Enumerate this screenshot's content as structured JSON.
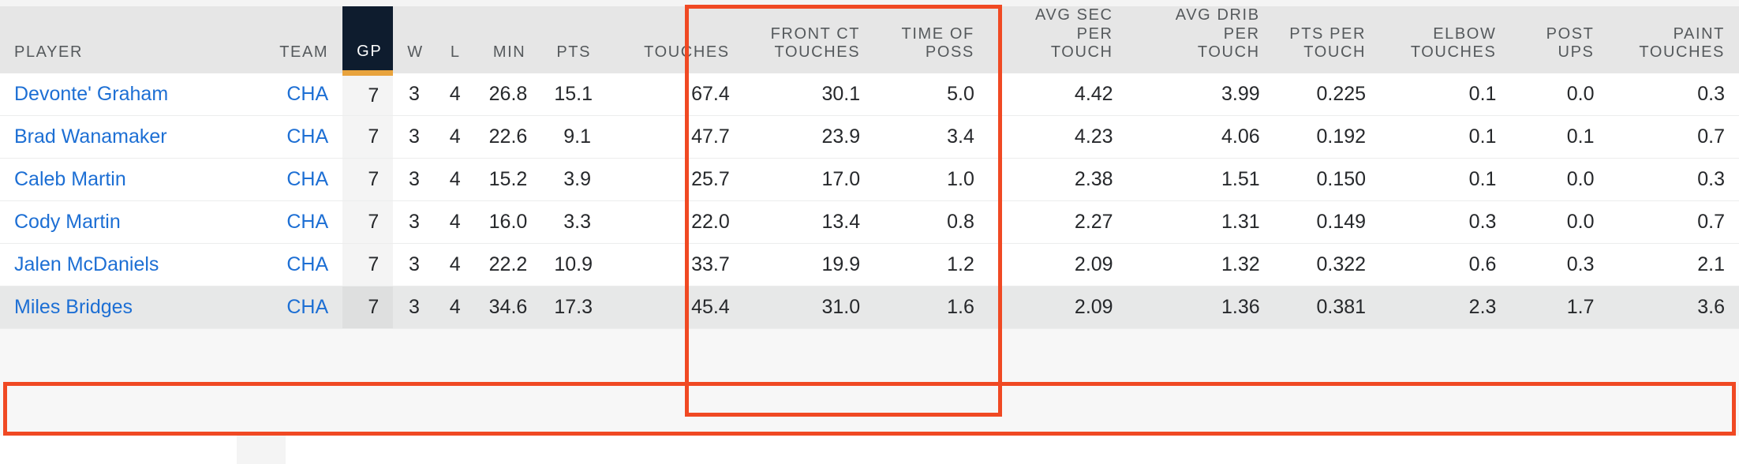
{
  "table": {
    "accent_navy": "#0e1c2e",
    "accent_gold": "#e8a33d",
    "link_blue": "#1d6fd4",
    "annotation_red": "#f04923",
    "columns": [
      {
        "key": "player",
        "label": "PLAYER",
        "align": "left"
      },
      {
        "key": "team",
        "label": "TEAM",
        "align": "right"
      },
      {
        "key": "gp",
        "label": "GP",
        "align": "right"
      },
      {
        "key": "w",
        "label": "W",
        "align": "right"
      },
      {
        "key": "l",
        "label": "L",
        "align": "right"
      },
      {
        "key": "min",
        "label": "MIN",
        "align": "right"
      },
      {
        "key": "pts",
        "label": "PTS",
        "align": "right"
      },
      {
        "key": "touches",
        "label": "TOUCHES",
        "align": "right"
      },
      {
        "key": "fct",
        "label": "FRONT CT\nTOUCHES",
        "align": "right"
      },
      {
        "key": "top",
        "label": "TIME OF\nPOSS",
        "align": "right"
      },
      {
        "key": "aspt",
        "label": "AVG SEC PER\nTOUCH",
        "align": "right"
      },
      {
        "key": "adpt",
        "label": "AVG DRIB PER\nTOUCH",
        "align": "right"
      },
      {
        "key": "ppt",
        "label": "PTS PER\nTOUCH",
        "align": "right"
      },
      {
        "key": "elbow",
        "label": "ELBOW\nTOUCHES",
        "align": "right"
      },
      {
        "key": "postup",
        "label": "POST\nUPS",
        "align": "right"
      },
      {
        "key": "paint",
        "label": "PAINT\nTOUCHES",
        "align": "right"
      }
    ],
    "rows": [
      {
        "player": "Devonte' Graham",
        "team": "CHA",
        "gp": "7",
        "w": "3",
        "l": "4",
        "min": "26.8",
        "pts": "15.1",
        "touches": "67.4",
        "fct": "30.1",
        "top": "5.0",
        "aspt": "4.42",
        "adpt": "3.99",
        "ppt": "0.225",
        "elbow": "0.1",
        "postup": "0.0",
        "paint": "0.3",
        "highlighted": false
      },
      {
        "player": "Brad Wanamaker",
        "team": "CHA",
        "gp": "7",
        "w": "3",
        "l": "4",
        "min": "22.6",
        "pts": "9.1",
        "touches": "47.7",
        "fct": "23.9",
        "top": "3.4",
        "aspt": "4.23",
        "adpt": "4.06",
        "ppt": "0.192",
        "elbow": "0.1",
        "postup": "0.1",
        "paint": "0.7",
        "highlighted": false
      },
      {
        "player": "Caleb Martin",
        "team": "CHA",
        "gp": "7",
        "w": "3",
        "l": "4",
        "min": "15.2",
        "pts": "3.9",
        "touches": "25.7",
        "fct": "17.0",
        "top": "1.0",
        "aspt": "2.38",
        "adpt": "1.51",
        "ppt": "0.150",
        "elbow": "0.1",
        "postup": "0.0",
        "paint": "0.3",
        "highlighted": false
      },
      {
        "player": "Cody Martin",
        "team": "CHA",
        "gp": "7",
        "w": "3",
        "l": "4",
        "min": "16.0",
        "pts": "3.3",
        "touches": "22.0",
        "fct": "13.4",
        "top": "0.8",
        "aspt": "2.27",
        "adpt": "1.31",
        "ppt": "0.149",
        "elbow": "0.3",
        "postup": "0.0",
        "paint": "0.7",
        "highlighted": false
      },
      {
        "player": "Jalen McDaniels",
        "team": "CHA",
        "gp": "7",
        "w": "3",
        "l": "4",
        "min": "22.2",
        "pts": "10.9",
        "touches": "33.7",
        "fct": "19.9",
        "top": "1.2",
        "aspt": "2.09",
        "adpt": "1.32",
        "ppt": "0.322",
        "elbow": "0.6",
        "postup": "0.3",
        "paint": "2.1",
        "highlighted": false
      },
      {
        "player": "Miles Bridges",
        "team": "CHA",
        "gp": "7",
        "w": "3",
        "l": "4",
        "min": "34.6",
        "pts": "17.3",
        "touches": "45.4",
        "fct": "31.0",
        "top": "1.6",
        "aspt": "2.09",
        "adpt": "1.36",
        "ppt": "0.381",
        "elbow": "2.3",
        "postup": "1.7",
        "paint": "3.6",
        "highlighted": true
      }
    ]
  }
}
